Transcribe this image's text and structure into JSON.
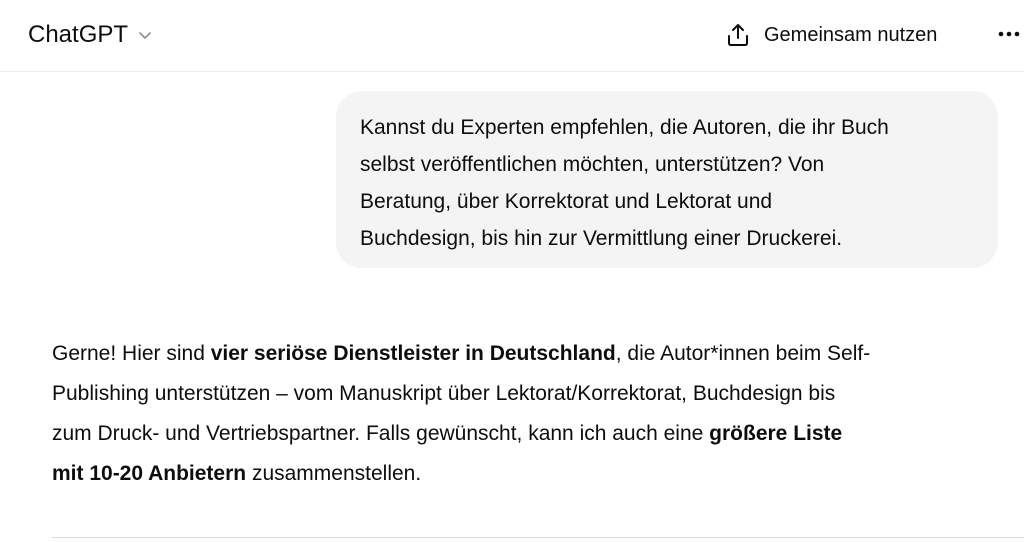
{
  "header": {
    "model_name": "ChatGPT",
    "share_label": "Gemeinsam nutzen",
    "model_chevron_icon": "chevron-down-icon",
    "share_icon": "upload-share-icon",
    "more_icon": "more-horizontal-icon"
  },
  "user_message": {
    "lines": [
      "Kannst du Experten empfehlen, die Autoren, die ihr Buch",
      "selbst veröffentlichen möchten, unterstützen? Von",
      "Beratung, über Korrektorat und Lektorat und",
      "Buchdesign, bis hin zur Vermittlung einer Druckerei."
    ]
  },
  "assistant_message": {
    "line1_start": "Gerne! Hier sind ",
    "line1_bold": "vier seriöse Dienstleister in Deutschland",
    "line1_end": ", die Autor*innen beim Self-",
    "line2": "Publishing unterstützen – vom Manuskript über Lektorat/Korrektorat, Buchdesign bis",
    "line3_start": "zum Druck- und Vertriebspartner. Falls gewünscht, kann ich auch eine ",
    "line3_bold": "größere Liste",
    "line4_bold": "mit 10-20 Anbietern",
    "line4_end": " zusammenstellen."
  },
  "colors": {
    "bubble_background": "#f4f4f4",
    "text": "#0d0d0d",
    "border": "#ececec"
  }
}
